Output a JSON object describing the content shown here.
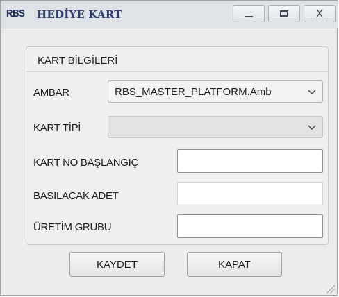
{
  "window": {
    "logo": "RBS",
    "title": "HEDİYE KART"
  },
  "icons": {
    "minimize": "minimize-icon",
    "maximize": "maximize-icon",
    "close": "close-icon",
    "dropdown": "chevron-down-icon",
    "resize": "resize-grip-icon"
  },
  "group": {
    "title": "KART BİLGİLERİ"
  },
  "fields": {
    "ambar": {
      "label": "AMBAR",
      "value": "RBS_MASTER_PLATFORM.Amb"
    },
    "kart_tipi": {
      "label": "KART TİPİ",
      "value": ""
    },
    "kart_no_baslangic": {
      "label": "KART NO BAŞLANGIÇ",
      "value": ""
    },
    "basilacak_adet": {
      "label": "BASILACAK ADET",
      "value": ""
    },
    "uretim_grubu": {
      "label": "ÜRETİM GRUBU",
      "value": ""
    }
  },
  "buttons": {
    "save": "KAYDET",
    "close": "KAPAT",
    "window_close_glyph": "X"
  },
  "colors": {
    "title_text": "#2f3e72",
    "titlebar_bg": "#dfe3e8",
    "window_bg": "#ececec",
    "disabled_combo_bg": "#e2e2e2"
  }
}
